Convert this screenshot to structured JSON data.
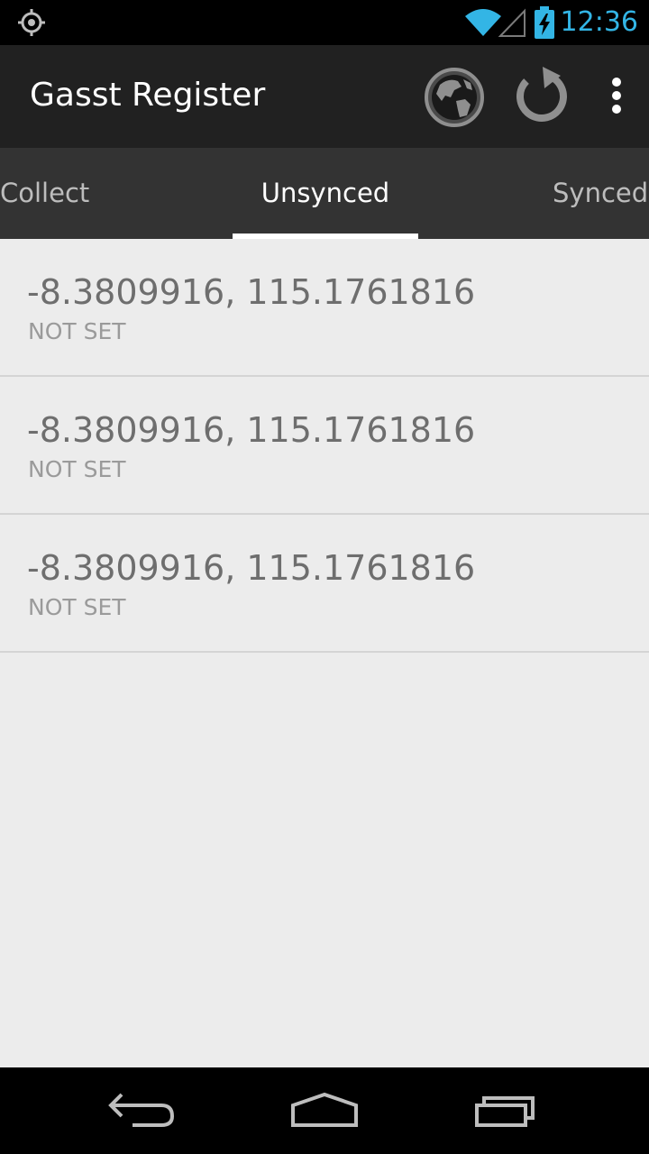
{
  "status_bar": {
    "time": "12:36",
    "icons": [
      "gps-icon",
      "wifi-icon",
      "signal-icon",
      "battery-charging-icon"
    ],
    "accent_color": "#33b5e5"
  },
  "action_bar": {
    "title": "Gasst Register",
    "actions": [
      "globe-icon",
      "refresh-icon",
      "overflow-menu-icon"
    ]
  },
  "tabs": [
    {
      "label": "Collect",
      "selected": false
    },
    {
      "label": "Unsynced",
      "selected": true
    },
    {
      "label": "Synced",
      "selected": false
    }
  ],
  "list": {
    "items": [
      {
        "coords": "-8.3809916, 115.1761816",
        "status": "NOT SET"
      },
      {
        "coords": "-8.3809916, 115.1761816",
        "status": "NOT SET"
      },
      {
        "coords": "-8.3809916, 115.1761816",
        "status": "NOT SET"
      }
    ]
  },
  "nav_bar": {
    "buttons": [
      "back-icon",
      "home-icon",
      "recent-apps-icon"
    ]
  }
}
